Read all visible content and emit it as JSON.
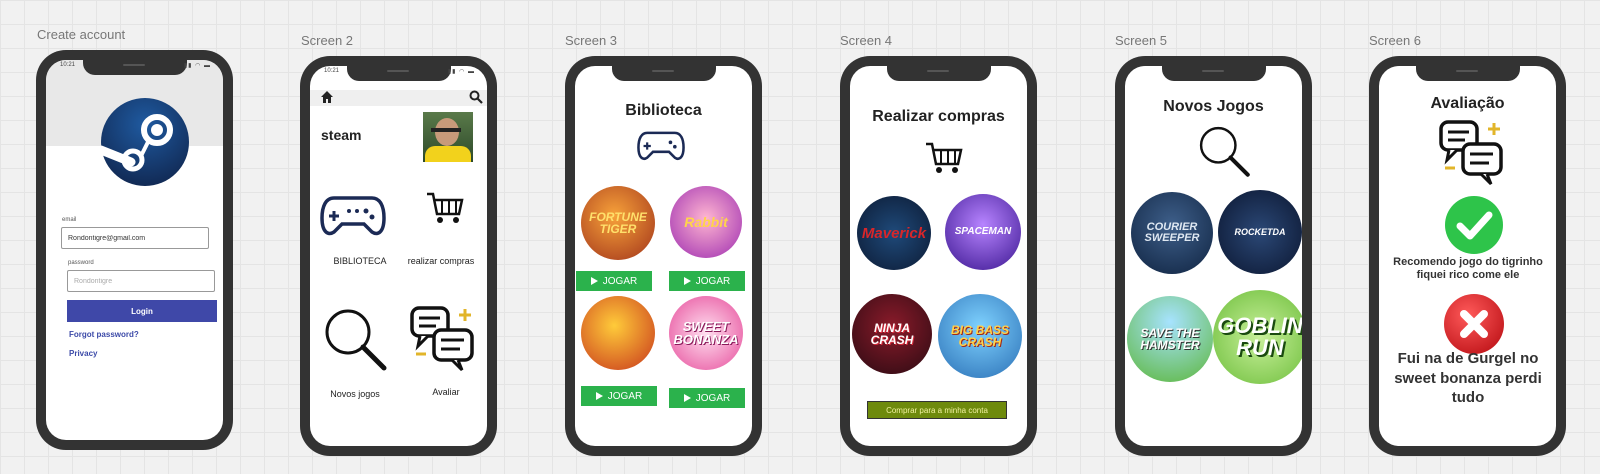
{
  "frames": {
    "create_account": "Create account",
    "screen2": "Screen 2",
    "screen3": "Screen 3",
    "screen4": "Screen 4",
    "screen5": "Screen 5",
    "screen6": "Screen 6"
  },
  "status_time": "10:21",
  "login": {
    "email_label": "email",
    "email_value": "Rondontigre@gmail.com",
    "password_label": "password",
    "password_placeholder": "Rondontigre",
    "login_button": "Login",
    "forgot_link": "Forgot password?",
    "privacy_link": "Privacy"
  },
  "home": {
    "title": "steam",
    "biblioteca_label": "BIBLIOTECA",
    "compras_label": "realizar compras",
    "novos_label": "Novos jogos",
    "avaliar_label": "Avaliar"
  },
  "biblioteca": {
    "title": "Biblioteca",
    "play_label": "JOGAR",
    "games": [
      "FORTUNE TIGER",
      "Rabbit",
      "",
      "SWEET BONANZA"
    ]
  },
  "compras": {
    "title": "Realizar compras",
    "games": [
      "Maverick",
      "SPACEMAN",
      "NINJA CRASH",
      "BIG BASS CRASH"
    ],
    "buy_button": "Comprar para a minha conta"
  },
  "novos": {
    "title": "Novos Jogos",
    "games": [
      "COURIER SWEEPER",
      "ROCKETDA",
      "SAVE THE HAMSTER",
      "GOBLIN RUN"
    ]
  },
  "avaliacao": {
    "title": "Avaliação",
    "positive_review": "Recomendo jogo do tigrinho fiquei rico come ele",
    "negative_review": "Fui na de Gurgel no sweet bonanza perdi tudo"
  },
  "colors": {
    "play_green": "#2bb24c",
    "login_blue": "#3f48a8",
    "buy_olive": "#6e8a0c",
    "steam_blue": "#1b3f7a"
  }
}
